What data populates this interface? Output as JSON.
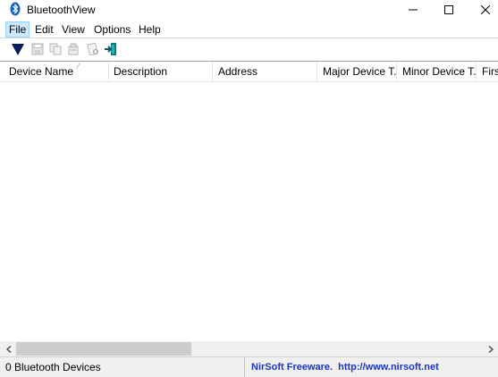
{
  "window": {
    "title": "BluetoothView",
    "icon": "bluetooth-icon",
    "controls": [
      "minimize-icon",
      "maximize-icon",
      "close-icon"
    ]
  },
  "menu": {
    "items": [
      "File",
      "Edit",
      "View",
      "Options",
      "Help"
    ],
    "active": "File"
  },
  "toolbar": {
    "buttons": [
      "start-stop-icon",
      "save-icon",
      "copy-icon",
      "properties-icon",
      "html-report-icon",
      "exit-icon"
    ]
  },
  "table": {
    "columns": [
      "Device Name",
      "Description",
      "Address",
      "Major Device T...",
      "Minor Device T...",
      "First"
    ],
    "sorted_column": "Device Name",
    "rows": []
  },
  "status": {
    "count_text": "0 Bluetooth Devices",
    "brand_text": "NirSoft Freeware.",
    "url_text": "http://www.nirsoft.net"
  },
  "colors": {
    "link": "#1a35c6",
    "menu_highlight": "#cce8ff",
    "bluetooth": "#1565c0"
  }
}
